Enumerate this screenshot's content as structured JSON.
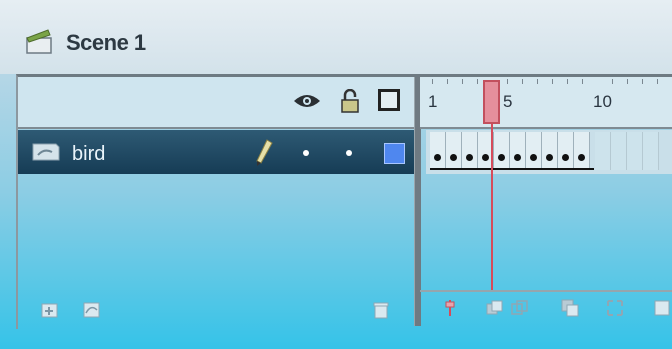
{
  "scene": {
    "title": "Scene 1"
  },
  "layers": [
    {
      "name": "bird",
      "color": "#4f87ef",
      "selected": true
    }
  ],
  "timeline": {
    "frame_numbers": [
      "1",
      "5",
      "10"
    ],
    "current_frame": 4,
    "keyframes": 10
  },
  "icons": {
    "scene": "clapper-icon",
    "visibility": "eye-icon",
    "lock": "lock-icon",
    "outline": "outline-icon",
    "layer_type": "layer-icon",
    "edit": "pencil-icon"
  }
}
